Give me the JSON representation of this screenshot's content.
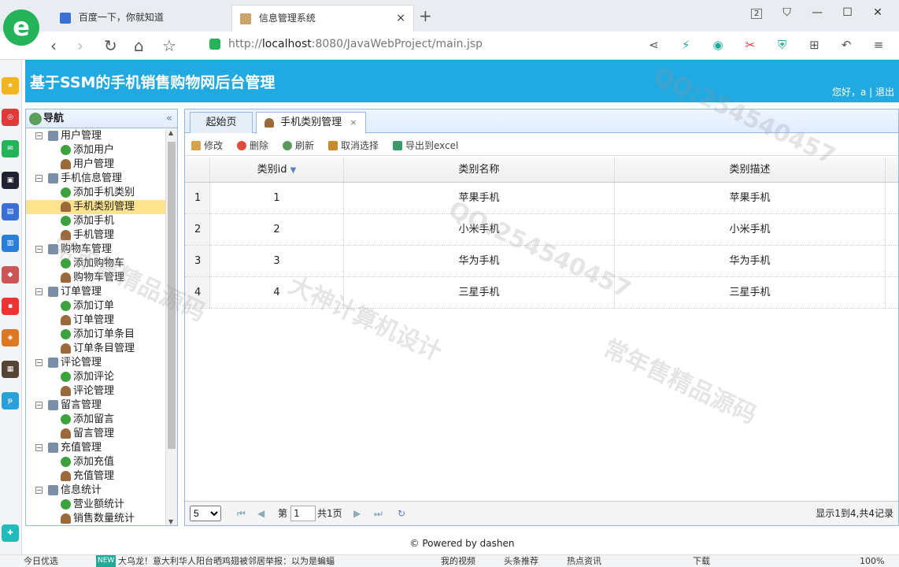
{
  "browser": {
    "logo": "e",
    "tabs": [
      {
        "title": "百度一下，你就知道"
      },
      {
        "title": "信息管理系统",
        "close": "×"
      }
    ],
    "new_tab": "+",
    "tab_count": "2",
    "url_prefix": "http://",
    "url_host": "localhost",
    "url_rest": ":8080/JavaWebProject/main.jsp"
  },
  "app": {
    "title": "基于SSM的手机销售购物网后台管理",
    "user_text": "您好，a | 退出"
  },
  "nav": {
    "title": "导航",
    "collapse": "«",
    "items": [
      {
        "label": "用户管理",
        "type": "parent"
      },
      {
        "label": "添加用户",
        "type": "add"
      },
      {
        "label": "用户管理",
        "type": "user"
      },
      {
        "label": "手机信息管理",
        "type": "parent"
      },
      {
        "label": "添加手机类别",
        "type": "add"
      },
      {
        "label": "手机类别管理",
        "type": "user",
        "selected": true
      },
      {
        "label": "添加手机",
        "type": "add"
      },
      {
        "label": "手机管理",
        "type": "user"
      },
      {
        "label": "购物车管理",
        "type": "parent"
      },
      {
        "label": "添加购物车",
        "type": "add"
      },
      {
        "label": "购物车管理",
        "type": "user"
      },
      {
        "label": "订单管理",
        "type": "parent"
      },
      {
        "label": "添加订单",
        "type": "add"
      },
      {
        "label": "订单管理",
        "type": "user"
      },
      {
        "label": "添加订单条目",
        "type": "add"
      },
      {
        "label": "订单条目管理",
        "type": "user"
      },
      {
        "label": "评论管理",
        "type": "parent"
      },
      {
        "label": "添加评论",
        "type": "add"
      },
      {
        "label": "评论管理",
        "type": "user"
      },
      {
        "label": "留言管理",
        "type": "parent"
      },
      {
        "label": "添加留言",
        "type": "add"
      },
      {
        "label": "留言管理",
        "type": "user"
      },
      {
        "label": "充值管理",
        "type": "parent"
      },
      {
        "label": "添加充值",
        "type": "add"
      },
      {
        "label": "充值管理",
        "type": "user"
      },
      {
        "label": "信息统计",
        "type": "parent"
      },
      {
        "label": "营业额统计",
        "type": "add"
      },
      {
        "label": "销售数量统计",
        "type": "user"
      }
    ]
  },
  "main": {
    "tabs": [
      {
        "label": "起始页"
      },
      {
        "label": "手机类别管理",
        "close": "×"
      }
    ],
    "toolbar": {
      "edit": "修改",
      "delete": "删除",
      "refresh": "刷新",
      "cancel": "取消选择",
      "export": "导出到excel"
    },
    "grid": {
      "columns": [
        "类别id",
        "类别名称",
        "类别描述"
      ],
      "rows": [
        {
          "n": "1",
          "id": "1",
          "name": "苹果手机",
          "desc": "苹果手机"
        },
        {
          "n": "2",
          "id": "2",
          "name": "小米手机",
          "desc": "小米手机"
        },
        {
          "n": "3",
          "id": "3",
          "name": "华为手机",
          "desc": "华为手机"
        },
        {
          "n": "4",
          "id": "4",
          "name": "三星手机",
          "desc": "三星手机"
        }
      ]
    },
    "pager": {
      "page_size": "5",
      "page_label": "第",
      "page_value": "1",
      "total_pages": "共1页",
      "summary": "显示1到4,共4记录"
    }
  },
  "footer": "© Powered by dashen",
  "statusbar": {
    "today": "今日优选",
    "news_badge": "NEW",
    "news": "大乌龙！意大利华人阳台晒鸡翅被邻居举报：以为是蝙蝠",
    "video": "我的视频",
    "headline": "头条推荐",
    "hot": "热点资讯",
    "download": "下载",
    "zoom": "100%"
  },
  "watermarks": [
    "QQ:254540457",
    "常年售精品源码",
    "大神计算机设计"
  ]
}
